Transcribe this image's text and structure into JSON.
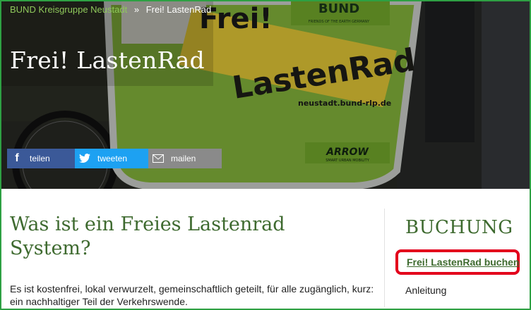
{
  "breadcrumb": {
    "parent": "BUND Kreisgruppe Neustadt",
    "separator": "»",
    "current": "Frei! LastenRad"
  },
  "hero": {
    "title": "Frei! LastenRad",
    "sign_brand": "Frei!",
    "sign_word": "LastenRad",
    "sign_url": "neustadt.bund-rlp.de",
    "top_logo": "BUND",
    "top_logo_sub": "FRIENDS OF THE EARTH GERMANY",
    "brand_logo": "ARROW",
    "brand_logo_sub": "SMART URBAN MOBILITY"
  },
  "share": {
    "facebook": {
      "icon": "facebook-icon",
      "label": "teilen",
      "color": "#3b5998"
    },
    "twitter": {
      "icon": "twitter-icon",
      "label": "tweeten",
      "color": "#1da1f2"
    },
    "mail": {
      "icon": "mail-icon",
      "label": "mailen",
      "color": "#8a8a8a"
    }
  },
  "main": {
    "heading": "Was ist ein Freies Lastenrad System?",
    "text": "Es ist kostenfrei, lokal verwurzelt, gemeinschaftlich geteilt, für alle zugänglich, kurz: ein nachhaltiger Teil der Verkehrswende."
  },
  "sidebar": {
    "heading": "BUCHUNG",
    "book_link": "Frei! LastenRad buchen",
    "guide_link": "Anleitung",
    "highlight_color": "#e3001b"
  },
  "colors": {
    "accent_green": "#3e6a2f",
    "frame_green": "#2ea043"
  }
}
